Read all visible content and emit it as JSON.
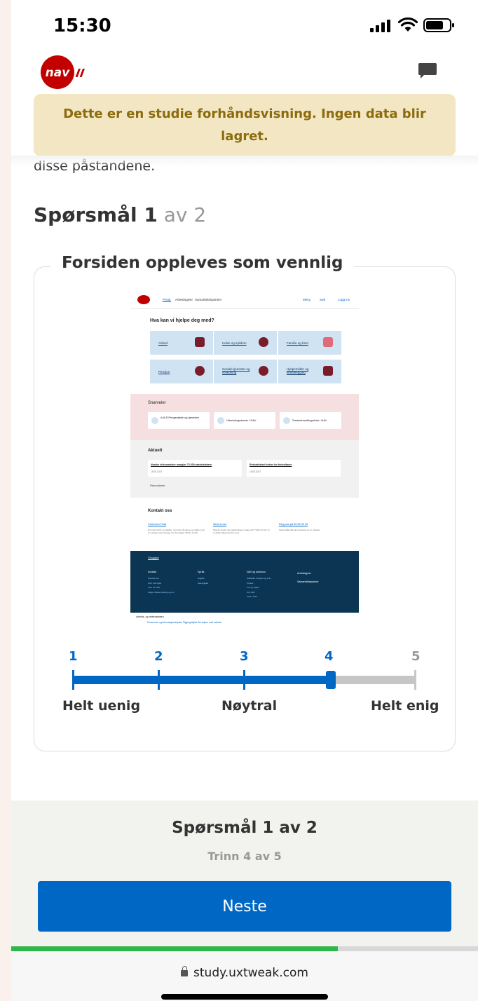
{
  "status_bar": {
    "time": "15:30"
  },
  "header": {
    "logo_text": "nav"
  },
  "banner": {
    "text": "Dette er en studie forhåndsvisning. Ingen data blir lagret."
  },
  "content": {
    "previous_text": "disse påstandene.",
    "question_prefix": "Spørsmål 1",
    "question_suffix": " av 2",
    "statement": "Forsiden oppleves som vennlig"
  },
  "preview": {
    "nav": [
      "Privat",
      "Arbeidsgiver",
      "Samarbeidspartner",
      "Meny",
      "Søk",
      "Logg inn"
    ],
    "heading": "Hva kan vi hjelpe deg med?",
    "tiles": [
      "Arbeid",
      "Helse og sykdom",
      "Familie og barn",
      "Pensjon",
      "Sosiale tjenester og veiledning",
      "Hjelpemidler og tilrettelegging"
    ],
    "shortcuts_title": "Snarveier",
    "shortcuts": [
      "A til Å Pengestøtte og tjenester",
      "Utbetalingsdatoer i NAV",
      "Saksbehandlingstider i NAV"
    ],
    "news_title": "Aktuelt",
    "news": [
      {
        "title": "Norske virksomheter mangler 73.000 arbeidstakere",
        "date": "18.05.2022"
      },
      {
        "title": "Rekorddstort behov for ferievikarer",
        "date": "18.05.2022"
      }
    ],
    "more_news": "Flere nyheter",
    "contact_title": "Kontakt oss",
    "contacts": [
      {
        "title": "Chat med Frida",
        "desc": "Du møter først en chatbot, men kan på videre og chatte med en veileder etter å logge inn (hverdager 09.00–14.30)."
      },
      {
        "title": "Skriv til oss",
        "desc": "Skal du sende oss opplysninger i saken din? \"Skriv til oss\" er et sikkert alternativ til e-post."
      },
      {
        "title": "Ring oss på 55 55 33 33",
        "desc": "Spørsmålet ditt kan besvares av en veileder."
      }
    ],
    "to_top": "Til toppen",
    "footer_cols": [
      {
        "title": "Kontakt",
        "links": [
          "Kontakt oss",
          "NAV i ditt fylke",
          "Kurs for NAV",
          "Klage, tilbakemelding og ros"
        ]
      },
      {
        "title": "Språk",
        "links": [
          "English",
          "Samegiella"
        ]
      },
      {
        "title": "NAV og samfunn",
        "links": [
          "Statistikk, analyse og FoU",
          "Presse",
          "Lov og regler",
          "Om NAV",
          "Jobb i NAV"
        ]
      }
    ],
    "footer_links": [
      "Arbeidsgiver",
      "Samarbeidspartner"
    ],
    "bottom_line": "Arbeids- og velferdsetaten",
    "bottom_links": "Personvern og informasjonskapsler   Tilgjengelighet   Del skjerm med veileder"
  },
  "scale": {
    "points": [
      "1",
      "2",
      "3",
      "4",
      "5"
    ],
    "selected": 4,
    "labels": {
      "left": "Helt uenig",
      "middle": "Nøytral",
      "right": "Helt enig"
    }
  },
  "footer": {
    "question": "Spørsmål 1 av 2",
    "step": "Trinn 4 av 5",
    "next_button": "Neste",
    "progress": 0.7
  },
  "browser": {
    "url": "study.uxtweak.com"
  },
  "colors": {
    "primary": "#0067c5",
    "banner_bg": "#f2e7c2",
    "banner_text": "#8c6b0e",
    "nav_red": "#c30000",
    "progress": "#2fb74b"
  },
  "icons": [
    "signal-icon",
    "wifi-icon",
    "battery-icon",
    "chat-icon",
    "lock-icon"
  ]
}
